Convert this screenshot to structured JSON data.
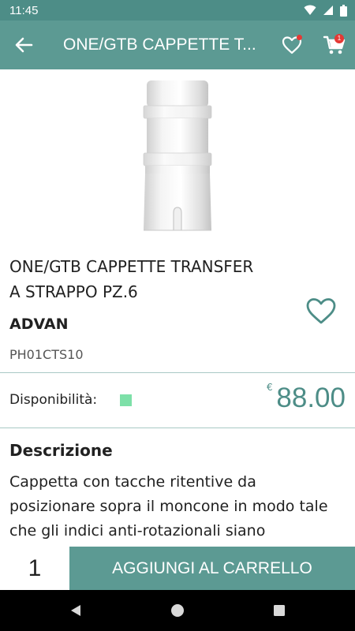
{
  "status_bar": {
    "time": "11:45",
    "icons": [
      "wifi-icon",
      "signal-icon",
      "battery-icon"
    ]
  },
  "app_bar": {
    "title": "ONE/GTB CAPPETTE T...",
    "back_icon": "arrow-left-icon",
    "favorites_icon": "heart-outline-icon",
    "cart_icon": "cart-icon",
    "cart_badge": "1"
  },
  "product": {
    "image_icon": "dental-transfer-cap-image",
    "title_line1": "ONE/GTB CAPPETTE TRANSFER",
    "title_line2": "A STRAPPO PZ.6",
    "brand": "ADVAN",
    "sku": "PH01CTS10",
    "wishlist_icon": "heart-outline-icon",
    "availability_label": "Disponibilità:",
    "availability_color": "#7de0a8",
    "price_currency": "€",
    "price_value": "88.00"
  },
  "description": {
    "heading": "Descrizione",
    "text": "Cappetta con tacche ritentive da posizionare sopra il moncone in modo tale che gli indici anti-rotazionali siano"
  },
  "actions": {
    "quantity": "1",
    "add_to_cart_label": "AGGIUNGI AL CARRELLO"
  },
  "nav_bar": {
    "icons": [
      "back-triangle-icon",
      "home-circle-icon",
      "recents-square-icon"
    ]
  },
  "colors": {
    "primary": "#5c9a93",
    "status_bar": "#4d8d87",
    "price": "#4d8d87",
    "badge": "#e53935"
  }
}
